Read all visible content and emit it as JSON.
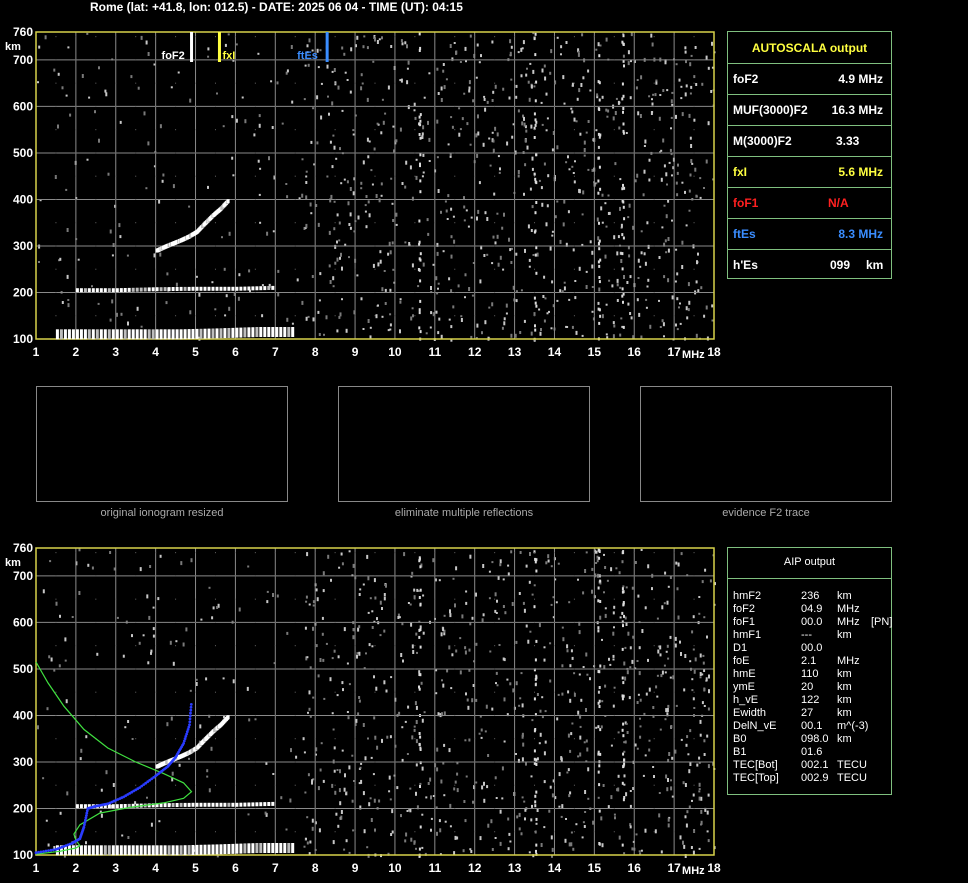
{
  "header": {
    "title": "Rome (lat: +41.8, lon: 012.5) - DATE: 2025 06 04 - TIME (UT): 04:15"
  },
  "chart_data": [
    {
      "type": "scatter",
      "title": "",
      "xlabel": "MHz",
      "ylabel": "km",
      "xlim": [
        1,
        18
      ],
      "ylim": [
        100,
        760
      ],
      "xticks": [
        "1",
        "2",
        "3",
        "4",
        "5",
        "6",
        "7",
        "8",
        "9",
        "10",
        "11",
        "12",
        "13",
        "14",
        "15",
        "16",
        "17",
        "18"
      ],
      "yticks": [
        "100",
        "200",
        "300",
        "400",
        "500",
        "600",
        "700",
        "760"
      ],
      "markers": [
        {
          "label": "foF2",
          "x": 4.9,
          "color": "#ffffff"
        },
        {
          "label": "fxI",
          "x": 5.6,
          "color": "#ffff40"
        },
        {
          "label": "ftEs",
          "x": 8.3,
          "color": "#3a8dff"
        }
      ],
      "traces": [
        {
          "name": "F2",
          "points": [
            [
              4.0,
              290
            ],
            [
              4.2,
              298
            ],
            [
              4.4,
              305
            ],
            [
              4.6,
              312
            ],
            [
              4.8,
              320
            ],
            [
              5.0,
              330
            ],
            [
              5.2,
              348
            ],
            [
              5.4,
              365
            ],
            [
              5.6,
              380
            ],
            [
              5.8,
              398
            ]
          ]
        },
        {
          "name": "F-layer 2nd",
          "points": [
            [
              2.0,
              205
            ],
            [
              3.0,
              205
            ],
            [
              4.0,
              207
            ],
            [
              5.0,
              208
            ],
            [
              6.0,
              208
            ],
            [
              7.0,
              210
            ]
          ]
        },
        {
          "name": "Es",
          "points": [
            [
              1.5,
              110
            ],
            [
              2.5,
              110
            ],
            [
              3.5,
              110
            ],
            [
              4.5,
              110
            ],
            [
              5.5,
              112
            ],
            [
              6.5,
              115
            ],
            [
              7.5,
              115
            ]
          ]
        }
      ]
    },
    {
      "type": "scatter",
      "title": "",
      "xlabel": "MHz",
      "ylabel": "km",
      "xlim": [
        1,
        18
      ],
      "ylim": [
        100,
        760
      ],
      "xticks": [
        "1",
        "2",
        "3",
        "4",
        "5",
        "6",
        "7",
        "8",
        "9",
        "10",
        "11",
        "12",
        "13",
        "14",
        "15",
        "16",
        "17",
        "18"
      ],
      "yticks": [
        "100",
        "200",
        "300",
        "400",
        "500",
        "600",
        "700",
        "760"
      ],
      "traces": [
        {
          "name": "F2",
          "points": [
            [
              4.0,
              290
            ],
            [
              4.2,
              298
            ],
            [
              4.4,
              305
            ],
            [
              4.6,
              312
            ],
            [
              4.8,
              320
            ],
            [
              5.0,
              330
            ],
            [
              5.2,
              348
            ],
            [
              5.4,
              365
            ],
            [
              5.6,
              380
            ],
            [
              5.8,
              398
            ]
          ]
        },
        {
          "name": "F-layer 2nd",
          "points": [
            [
              2.0,
              205
            ],
            [
              3.0,
              205
            ],
            [
              4.0,
              207
            ],
            [
              5.0,
              208
            ],
            [
              6.0,
              208
            ],
            [
              7.0,
              210
            ]
          ]
        },
        {
          "name": "Es",
          "points": [
            [
              1.5,
              110
            ],
            [
              2.5,
              110
            ],
            [
              3.5,
              110
            ],
            [
              4.5,
              110
            ],
            [
              5.5,
              112
            ],
            [
              6.5,
              115
            ],
            [
              7.5,
              115
            ]
          ]
        }
      ],
      "lines": [
        {
          "name": "electron density profile",
          "color": "#40e040",
          "points": [
            [
              1.0,
              515
            ],
            [
              1.3,
              470
            ],
            [
              1.7,
              420
            ],
            [
              2.2,
              370
            ],
            [
              2.8,
              330
            ],
            [
              3.5,
              300
            ],
            [
              4.2,
              275
            ],
            [
              4.7,
              255
            ],
            [
              4.9,
              236
            ],
            [
              4.7,
              222
            ],
            [
              4.2,
              212
            ],
            [
              3.4,
              203
            ],
            [
              2.6,
              190
            ],
            [
              2.1,
              165
            ],
            [
              1.95,
              145
            ],
            [
              2.0,
              132
            ],
            [
              2.1,
              120
            ],
            [
              2.0,
              115
            ],
            [
              1.6,
              108
            ],
            [
              1.0,
              102
            ]
          ]
        },
        {
          "name": "computed trace",
          "color": "#2a3cff",
          "points": [
            [
              1.0,
              105
            ],
            [
              1.5,
              112
            ],
            [
              1.9,
              125
            ],
            [
              2.1,
              135
            ],
            [
              2.2,
              160
            ],
            [
              2.3,
              200
            ],
            [
              2.5,
              205
            ],
            [
              2.8,
              210
            ],
            [
              3.2,
              225
            ],
            [
              3.6,
              245
            ],
            [
              4.0,
              270
            ],
            [
              4.3,
              290
            ],
            [
              4.5,
              310
            ],
            [
              4.7,
              340
            ],
            [
              4.85,
              380
            ],
            [
              4.9,
              430
            ]
          ]
        }
      ]
    }
  ],
  "autoscala": {
    "title": "AUTOSCALA output",
    "rows": [
      {
        "label": "foF2",
        "value": "4.9 MHz",
        "color": "#ffffff"
      },
      {
        "label": "MUF(3000)F2",
        "value": "16.3 MHz",
        "color": "#ffffff"
      },
      {
        "label": "M(3000)F2",
        "value": "3.33",
        "color": "#ffffff"
      },
      {
        "label": "fxI",
        "value": "5.6 MHz",
        "color": "#ffff40"
      },
      {
        "label": "foF1",
        "value": "N/A",
        "color": "#ff2020"
      },
      {
        "label": "ftEs",
        "value": "8.3 MHz",
        "color": "#3a8dff"
      },
      {
        "label": "h'Es",
        "value": "099",
        "unit": "km",
        "color": "#ffffff"
      }
    ]
  },
  "thumbnails": [
    {
      "caption": "original ionogram resized"
    },
    {
      "caption": "eliminate multiple reflections"
    },
    {
      "caption": "evidence F2 trace"
    }
  ],
  "aip": {
    "title": "AIP output",
    "rows": [
      {
        "name": "hmF2",
        "value": "236",
        "unit": "km"
      },
      {
        "name": "foF2",
        "value": "04.9",
        "unit": "MHz"
      },
      {
        "name": "foF1",
        "value": "00.0",
        "unit": "MHz",
        "extra": "[PN]"
      },
      {
        "name": "hmF1",
        "value": "---",
        "unit": "km"
      },
      {
        "name": "D1",
        "value": "00.0",
        "unit": ""
      },
      {
        "name": "foE",
        "value": "2.1",
        "unit": "MHz"
      },
      {
        "name": "hmE",
        "value": "110",
        "unit": "km"
      },
      {
        "name": "ymE",
        "value": "20",
        "unit": "km"
      },
      {
        "name": "h_vE",
        "value": "122",
        "unit": "km"
      },
      {
        "name": "Ewidth",
        "value": "27",
        "unit": "km"
      },
      {
        "name": "DelN_vE",
        "value": "00.1",
        "unit": "m^(-3)"
      },
      {
        "name": "B0",
        "value": "098.0",
        "unit": "km"
      },
      {
        "name": "B1",
        "value": "01.6",
        "unit": ""
      },
      {
        "name": "TEC[Bot]",
        "value": "002.1",
        "unit": "TECU"
      },
      {
        "name": "TEC[Top]",
        "value": "002.9",
        "unit": "TECU"
      }
    ]
  }
}
